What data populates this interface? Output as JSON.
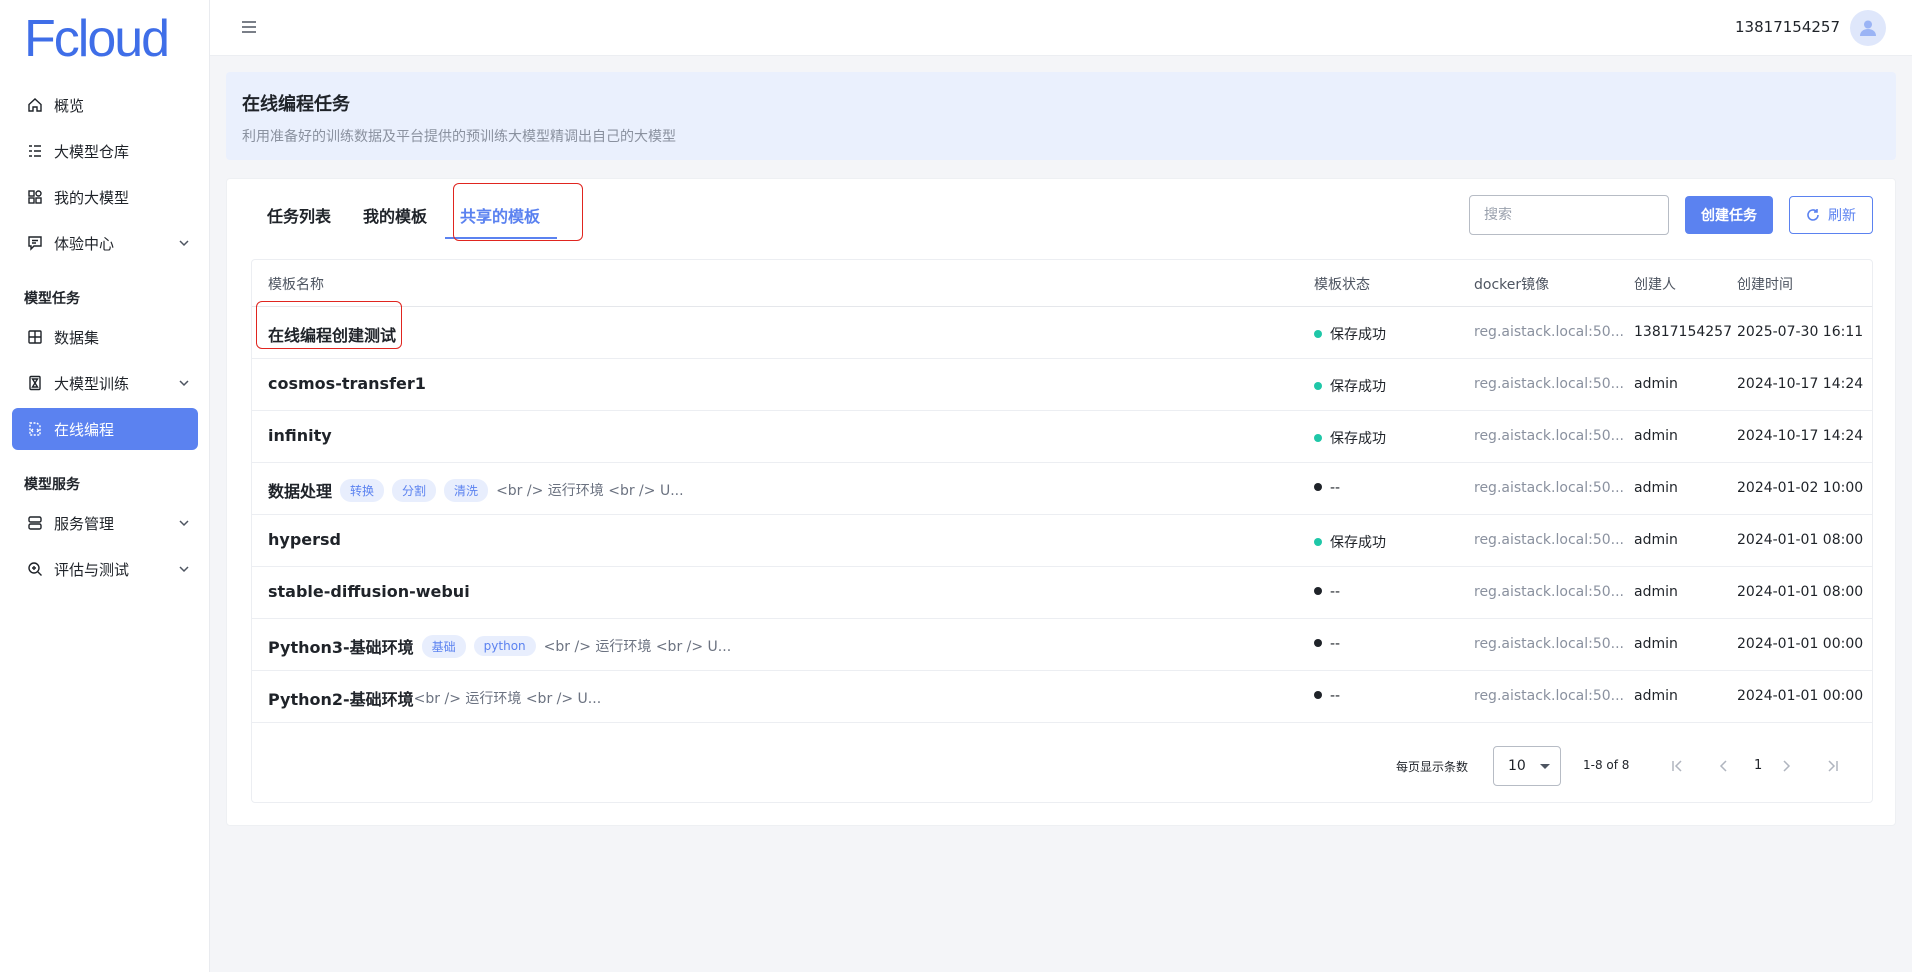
{
  "app": {
    "logo_text": "Fcloud",
    "brand_color": "#3f6ee8",
    "accent": "#5b82f0"
  },
  "sidebar": {
    "items": [
      {
        "label": "概览",
        "icon": "home-icon"
      },
      {
        "label": "大模型仓库",
        "icon": "list-icon"
      },
      {
        "label": "我的大模型",
        "icon": "grid-icon"
      },
      {
        "label": "体验中心",
        "icon": "chat-icon",
        "expandable": true
      }
    ],
    "group1_title": "模型任务",
    "group1_items": [
      {
        "label": "数据集",
        "icon": "table-icon"
      },
      {
        "label": "大模型训练",
        "icon": "hourglass-icon",
        "expandable": true
      },
      {
        "label": "在线编程",
        "icon": "code-file-icon",
        "active": true
      }
    ],
    "group2_title": "模型服务",
    "group2_items": [
      {
        "label": "服务管理",
        "icon": "server-icon",
        "expandable": true
      },
      {
        "label": "评估与测试",
        "icon": "search-zoom-icon",
        "expandable": true
      }
    ]
  },
  "header": {
    "user": "13817154257"
  },
  "banner": {
    "title": "在线编程任务",
    "subtitle": "利用准备好的训练数据及平台提供的预训练大模型精调出自己的大模型"
  },
  "tabs": [
    {
      "label": "任务列表",
      "active": false
    },
    {
      "label": "我的模板",
      "active": false
    },
    {
      "label": "共享的模板",
      "active": true
    }
  ],
  "toolbar": {
    "search_placeholder": "搜索",
    "create_label": "创建任务",
    "refresh_label": "刷新"
  },
  "table": {
    "headers": [
      "模板名称",
      "模板状态",
      "docker镜像",
      "创建人",
      "创建时间"
    ],
    "rows": [
      {
        "name": "在线编程创建测试",
        "tags": [],
        "desc": "",
        "status": "保存成功",
        "status_color": "#1fc7a8",
        "image": "reg.aistack.local:50...",
        "creator": "13817154257",
        "time": "2025-07-30 16:11"
      },
      {
        "name": "cosmos-transfer1",
        "tags": [],
        "desc": "",
        "status": "保存成功",
        "status_color": "#1fc7a8",
        "image": "reg.aistack.local:50...",
        "creator": "admin",
        "time": "2024-10-17 14:24"
      },
      {
        "name": "infinity",
        "tags": [],
        "desc": "",
        "status": "保存成功",
        "status_color": "#1fc7a8",
        "image": "reg.aistack.local:50...",
        "creator": "admin",
        "time": "2024-10-17 14:24"
      },
      {
        "name": "数据处理",
        "tags": [
          "转换",
          "分割",
          "清洗"
        ],
        "desc": "<br /> 运行环境 <br /> U...",
        "status": "--",
        "status_color": "#1f2329",
        "image": "reg.aistack.local:50...",
        "creator": "admin",
        "time": "2024-01-02 10:00"
      },
      {
        "name": "hypersd",
        "tags": [],
        "desc": "",
        "status": "保存成功",
        "status_color": "#1fc7a8",
        "image": "reg.aistack.local:50...",
        "creator": "admin",
        "time": "2024-01-01 08:00"
      },
      {
        "name": "stable-diffusion-webui",
        "tags": [],
        "desc": "",
        "status": "--",
        "status_color": "#1f2329",
        "image": "reg.aistack.local:50...",
        "creator": "admin",
        "time": "2024-01-01 08:00"
      },
      {
        "name": "Python3-基础环境",
        "tags": [
          "基础",
          "python"
        ],
        "desc": "<br /> 运行环境 <br /> U...",
        "status": "--",
        "status_color": "#1f2329",
        "image": "reg.aistack.local:50...",
        "creator": "admin",
        "time": "2024-01-01 00:00"
      },
      {
        "name": "Python2-基础环境",
        "tags": [],
        "desc": "<br /> 运行环境 <br /> U...",
        "desc_tight": true,
        "status": "--",
        "status_color": "#1f2329",
        "image": "reg.aistack.local:50...",
        "creator": "admin",
        "time": "2024-01-01 00:00"
      }
    ]
  },
  "pagination": {
    "per_page_label": "每页显示条数",
    "per_page": "10",
    "range": "1-8 of 8",
    "page": "1"
  }
}
